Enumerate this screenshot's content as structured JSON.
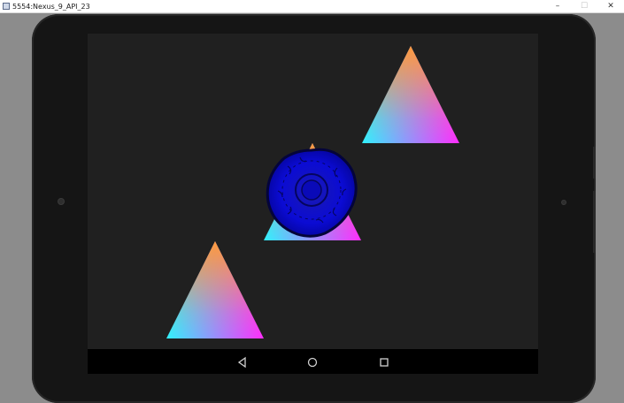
{
  "window": {
    "title": "5554:Nexus_9_API_23",
    "controls": [
      {
        "name": "minimize",
        "glyph": "–"
      },
      {
        "name": "maximize",
        "glyph": "☐"
      },
      {
        "name": "close",
        "glyph": "✕"
      }
    ]
  },
  "screen": {
    "background_color": "#202020",
    "triangle_gradient_colors": [
      "#ff9a3c",
      "#2ff2ff",
      "#ff2cff"
    ],
    "sprite_color": "#0a0acc"
  },
  "navbar": {
    "buttons": [
      {
        "name": "back",
        "icon": "back-triangle-icon"
      },
      {
        "name": "home",
        "icon": "home-circle-icon"
      },
      {
        "name": "recents",
        "icon": "recents-square-icon"
      }
    ]
  }
}
